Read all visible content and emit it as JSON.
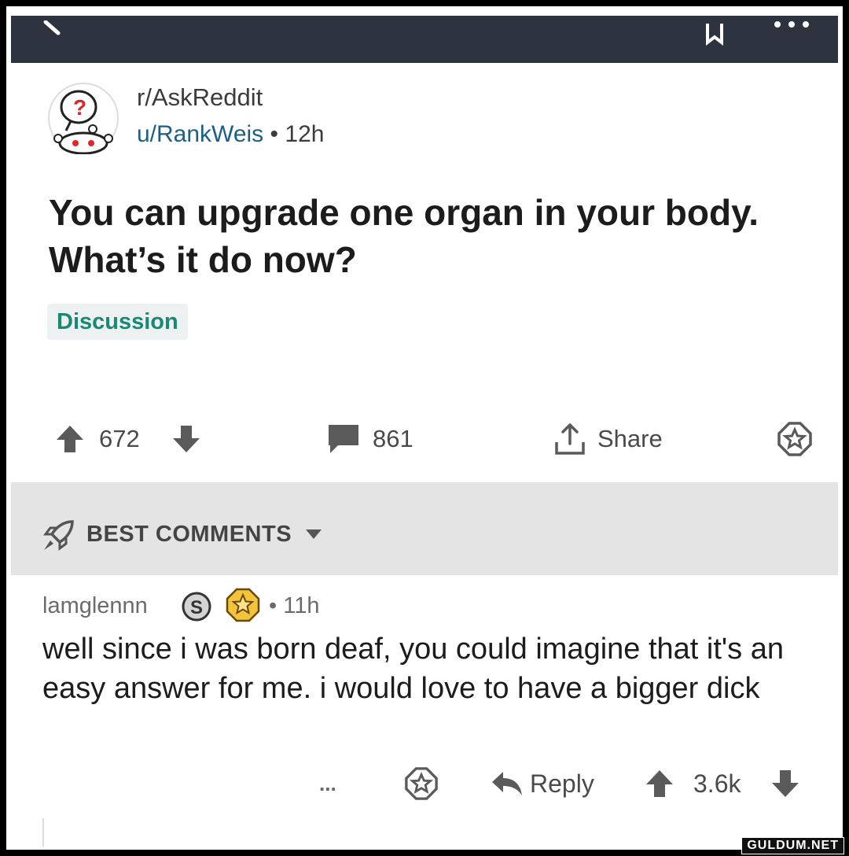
{
  "header": {
    "subreddit": "r/AskReddit",
    "author": "u/RankWeis",
    "separator": "•",
    "age": "12h"
  },
  "post": {
    "title": "You can upgrade one organ in your body. What’s it do now?",
    "flair": "Discussion",
    "upvotes": "672",
    "comments": "861",
    "share_label": "Share"
  },
  "comments_section": {
    "sort_label": "BEST COMMENTS"
  },
  "comment": {
    "author": "lamglennn",
    "separator": "•",
    "age": "11h",
    "silver_badge_letter": "S",
    "body": "well since i was born deaf, you could imagine that it's an easy answer for me. i would love to have a bigger dick",
    "more_label": "...",
    "reply_label": "Reply",
    "score": "3.6k"
  },
  "watermark": "GULDUM.NET",
  "colors": {
    "topbar": "#2d3440",
    "username": "#1a5f86",
    "flair_text": "#168a73",
    "flair_bg": "#eef1f2",
    "comments_bar": "#e4e4e4"
  }
}
